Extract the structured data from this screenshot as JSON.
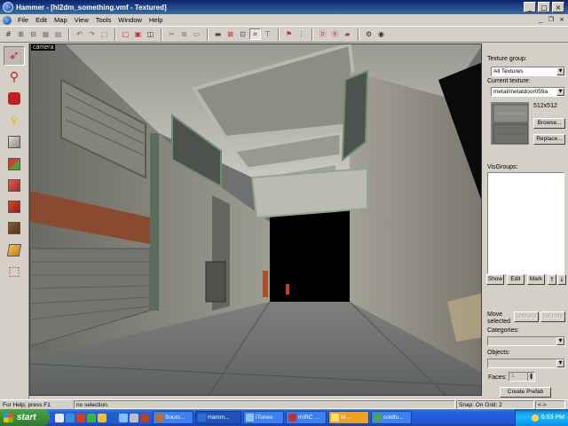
{
  "window": {
    "title": "Hammer - [hl2dm_something.vmf - Textured]",
    "minimize": "_",
    "maximize": "□",
    "close": "×"
  },
  "menu": {
    "items": [
      "File",
      "Edit",
      "Map",
      "View",
      "Tools",
      "Window",
      "Help"
    ],
    "mdi_minimize": "_",
    "mdi_restore": "❐",
    "mdi_close": "×"
  },
  "toolbar": {
    "icons": [
      "grid-icon",
      "grid-smaller-icon",
      "grid-larger-icon",
      "texture-lock-icon",
      "cut-icon",
      "copy-icon",
      "paste-icon",
      "group-icon",
      "ungroup-icon",
      "hide-icon",
      "carve-icon",
      "clip-icon",
      "run-map-icon",
      "camera-icon"
    ]
  },
  "viewport": {
    "label": "camera"
  },
  "panel": {
    "texture_group_label": "Texture group:",
    "texture_group_value": "All Textures",
    "current_texture_label": "Current texture:",
    "current_texture_value": "metal/metaldoor059a",
    "texture_size": "512x512",
    "browse_label": "Browse...",
    "replace_label": "Replace...",
    "visgroups_label": "VisGroups:",
    "show_label": "Show",
    "edit_label": "Edit",
    "mark_label": "Mark",
    "up_label": "↑",
    "down_label": "↓",
    "move_selected_label": "Move selected",
    "to_world_label": "toWorld",
    "to_entity_label": "toEntity",
    "categories_label": "Categories:",
    "objects_label": "Objects:",
    "faces_label": "Faces:",
    "faces_value": "1",
    "create_prefab_label": "Create Prefab"
  },
  "status": {
    "help": "For Help, press F1",
    "selection": "no selection.",
    "snap": "Snap: On Grid: 2",
    "zoom": "<->"
  },
  "taskbar": {
    "start_label": "start",
    "tasks": [
      {
        "label": "Sourc...",
        "active": false,
        "color": "#c46a2a"
      },
      {
        "label": "Hamm...",
        "active": true,
        "color": "#2f6fd0"
      },
      {
        "label": "iTunes",
        "active": false,
        "color": "#8fc0ff"
      },
      {
        "label": "mIRC ...",
        "active": false,
        "color": "#c03030"
      },
      {
        "label": "M...",
        "active": false,
        "color": "#f0a020"
      },
      {
        "label": "coldfu...",
        "active": false,
        "color": "#50a050"
      }
    ],
    "clock": "6:53 PM"
  },
  "colors": {
    "window_face": "#d4d0c8",
    "title_active": "#0a246a",
    "taskbar": "#245edc",
    "start": "#3c8f3a"
  }
}
